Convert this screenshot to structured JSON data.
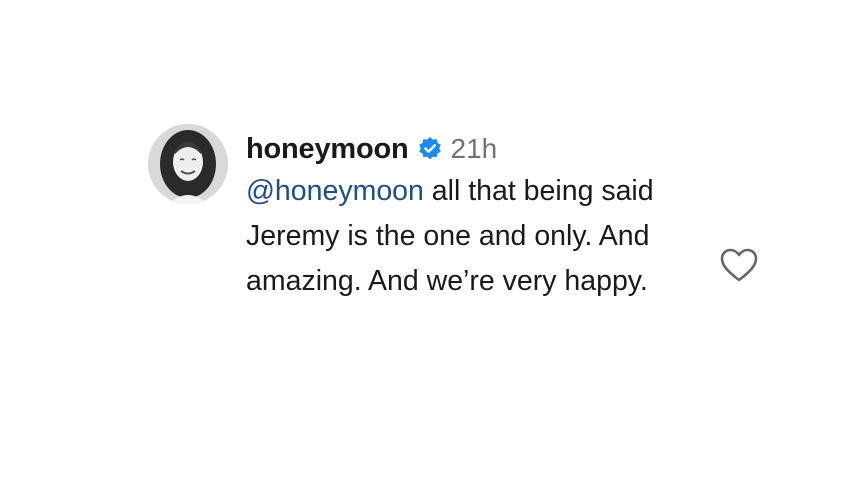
{
  "comment": {
    "username": "honeymoon",
    "timestamp": "21h",
    "mention": "@honeymoon",
    "text": " all that being said Jeremy is the one and only. And amazing. And we’re very happy.",
    "verified_icon": "verified-badge-icon",
    "like_icon": "heart-outline-icon",
    "colors": {
      "mention": "#1f4f86",
      "verified": "#1a8cf0",
      "timestamp": "#737373"
    }
  }
}
